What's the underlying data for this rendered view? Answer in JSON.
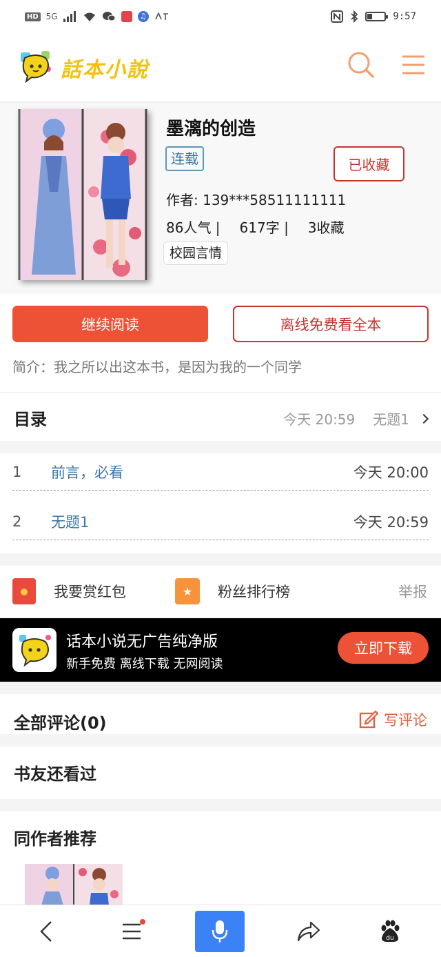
{
  "status_bar": {
    "network_label": "HD",
    "network_type": "5G",
    "music_label": "♫",
    "time": "9:57",
    "battery_level": 0.3
  },
  "header": {
    "logo_text": "話本小說",
    "search_icon": "search-icon",
    "menu_icon": "menu-icon",
    "accent_color": "#f0a070"
  },
  "book": {
    "title": "墨漓的创造",
    "status": "连载",
    "collect_label": "已收藏",
    "author": "作者: 139***58511111111",
    "popularity": "86人气 |",
    "word_count": "617字 |",
    "favorites": "3收藏",
    "tag": "校园言情"
  },
  "actions": {
    "continue_label": "继续阅读",
    "offline_label": "离线免费看全本",
    "intro": "简介：我之所以出这本书，是因为我的一个同学"
  },
  "toc": {
    "title": "目录",
    "latest_time": "今天 20:59",
    "latest_chapter": "无题1",
    "chapters": [
      {
        "num": "1",
        "title": "前言，必看",
        "time": "今天 20:00"
      },
      {
        "num": "2",
        "title": "无题1",
        "time": "今天 20:59"
      }
    ]
  },
  "reward": {
    "red_packet_label": "我要赏红包",
    "fans_rank_label": "粉丝排行榜",
    "report_label": "举报"
  },
  "ad": {
    "title": "话本小说无广告纯净版",
    "subtitle": "新手免费 离线下载 无网阅读",
    "download_label": "立即下载"
  },
  "comments": {
    "title": "全部评论(0)",
    "write_label": "写评论"
  },
  "also_read": {
    "title": "书友还看过"
  },
  "same_author": {
    "title": "同作者推荐"
  },
  "bottom_nav": {
    "back_icon": "back-icon",
    "list_icon": "list-icon",
    "voice_icon": "microphone-icon",
    "share_icon": "share-icon",
    "baidu_icon": "baidu-paw-icon",
    "baidu_text": "du"
  },
  "colors": {
    "primary_red": "#ee5236",
    "outline_red": "#c5332f",
    "link_blue": "#3a74a8",
    "voice_blue": "#3b82f6"
  }
}
